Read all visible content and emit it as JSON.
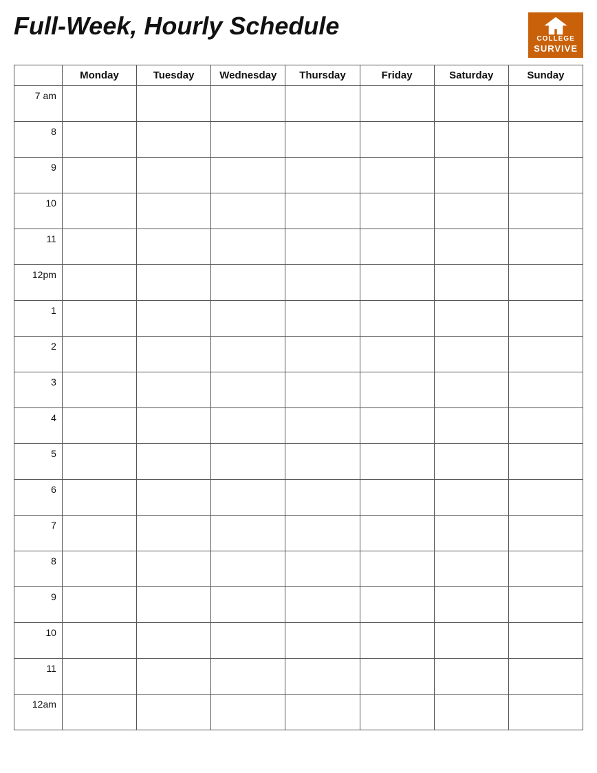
{
  "header": {
    "title": "Full-Week, Hourly Schedule",
    "logo": {
      "college_text": "COLLEGE",
      "survive_text": "SURVIVE"
    }
  },
  "table": {
    "time_header": "",
    "days": [
      "Monday",
      "Tuesday",
      "Wednesday",
      "Thursday",
      "Friday",
      "Saturday",
      "Sunday"
    ],
    "times": [
      "7 am",
      "8",
      "9",
      "10",
      "11",
      "12pm",
      "1",
      "2",
      "3",
      "4",
      "5",
      "6",
      "7",
      "8",
      "9",
      "10",
      "11",
      "12am"
    ]
  }
}
